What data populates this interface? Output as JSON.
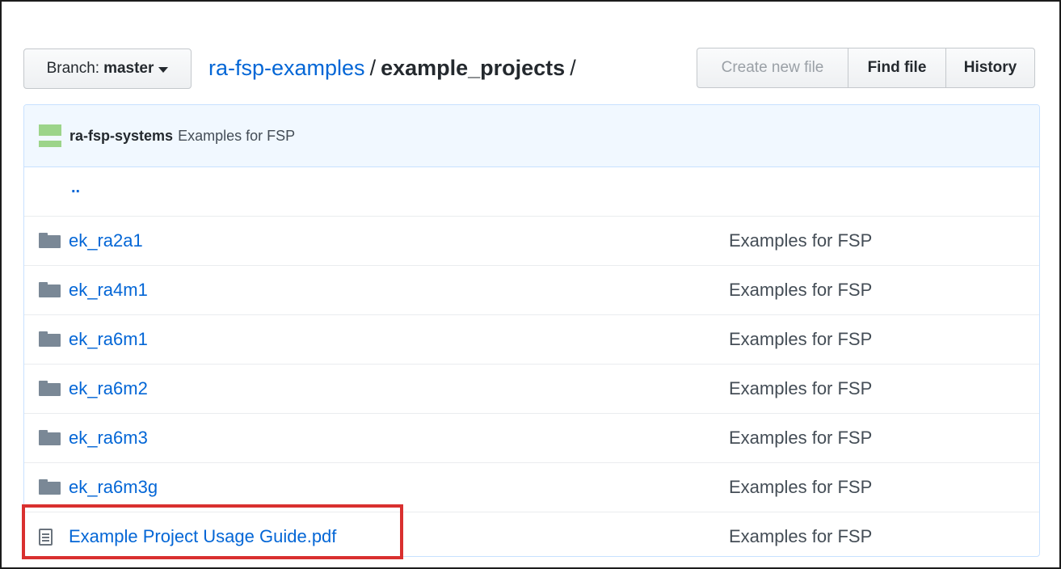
{
  "toolbar": {
    "branch_label": "Branch:",
    "branch_name": "master",
    "create_new_file": "Create new file",
    "find_file": "Find file",
    "history": "History"
  },
  "breadcrumb": {
    "repo": "ra-fsp-examples",
    "separator": "/",
    "path": "example_projects",
    "trailing": "/"
  },
  "commit": {
    "author": "ra-fsp-systems",
    "message": "Examples for FSP"
  },
  "parent_dir": "..",
  "files": [
    {
      "name": "ek_ra2a1",
      "type": "folder",
      "message": "Examples for FSP"
    },
    {
      "name": "ek_ra4m1",
      "type": "folder",
      "message": "Examples for FSP"
    },
    {
      "name": "ek_ra6m1",
      "type": "folder",
      "message": "Examples for FSP"
    },
    {
      "name": "ek_ra6m2",
      "type": "folder",
      "message": "Examples for FSP"
    },
    {
      "name": "ek_ra6m3",
      "type": "folder",
      "message": "Examples for FSP"
    },
    {
      "name": "ek_ra6m3g",
      "type": "folder",
      "message": "Examples for FSP"
    },
    {
      "name": "Example Project Usage Guide.pdf",
      "type": "file",
      "message": "Examples for FSP"
    }
  ],
  "colors": {
    "link": "#0366d6",
    "highlight_box": "#d9302f",
    "commit_bar": "#f1f8ff"
  }
}
